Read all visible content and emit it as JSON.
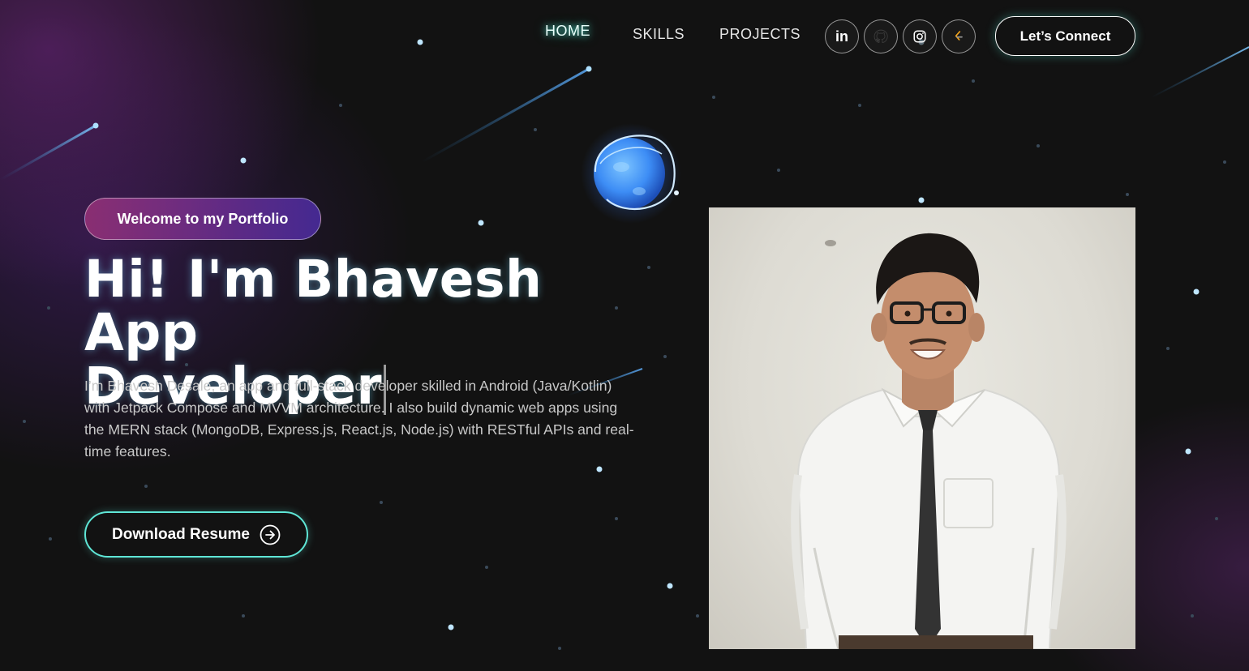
{
  "nav": {
    "links": [
      {
        "label": "HOME",
        "active": true
      },
      {
        "label": "SKILLS",
        "active": false
      },
      {
        "label": "PROJECTS",
        "active": false
      }
    ],
    "socials": [
      "linkedin-icon",
      "github-icon",
      "instagram-icon",
      "leetcode-icon"
    ],
    "cta_label": "Let’s Connect"
  },
  "hero": {
    "badge": "Welcome to my Portfolio",
    "title_line1": "Hi! I'm Bhavesh App",
    "title_line2": "Developer",
    "description": "I’m Bhavesh Desale, an app and full-stack developer skilled in Android (Java/Kotlin) with Jetpack Compose and MVVM architecture. I also build dynamic web apps using the MERN stack (MongoDB, Express.js, React.js, Node.js) with RESTful APIs and real-time features.",
    "resume_label": "Download Resume"
  },
  "colors": {
    "background": "#121212",
    "accent_teal": "#5fe6d6",
    "badge_pink": "#aa367c",
    "badge_purple": "#4a2fbd",
    "planet_blue": "#4aa8ff"
  }
}
